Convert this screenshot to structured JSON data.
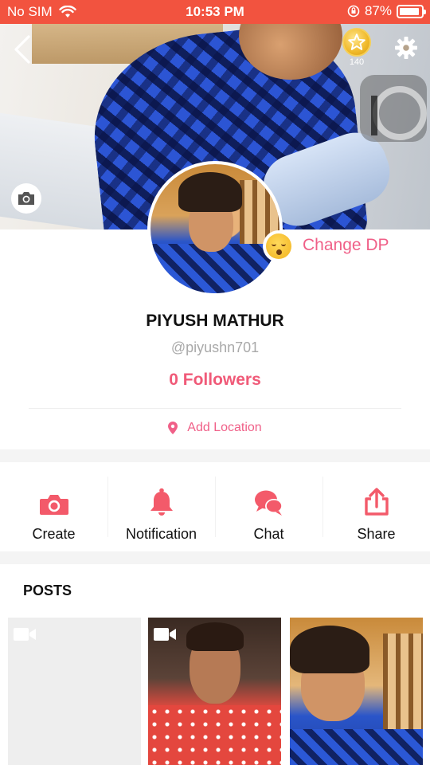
{
  "status_bar": {
    "carrier": "No SIM",
    "time": "10:53 PM",
    "battery": "87%"
  },
  "header": {
    "coins": "140"
  },
  "profile": {
    "change_dp_label": "Change DP",
    "name": "PIYUSH MATHUR",
    "handle": "@piyushn701",
    "followers": "0 Followers",
    "add_location_label": "Add Location"
  },
  "actions": [
    {
      "label": "Create",
      "icon": "camera-icon"
    },
    {
      "label": "Notification",
      "icon": "bell-icon"
    },
    {
      "label": "Chat",
      "icon": "chat-bubbles-icon"
    },
    {
      "label": "Share",
      "icon": "share-icon"
    }
  ],
  "posts": {
    "title": "POSTS",
    "items": [
      {
        "type": "video",
        "icon": "video-camera-icon"
      },
      {
        "type": "video",
        "icon": "video-camera-icon"
      },
      {
        "type": "photo"
      }
    ]
  },
  "colors": {
    "status_bar": "#f2533f",
    "accent_pink": "#f06088",
    "icon_red": "#f35a6a"
  }
}
